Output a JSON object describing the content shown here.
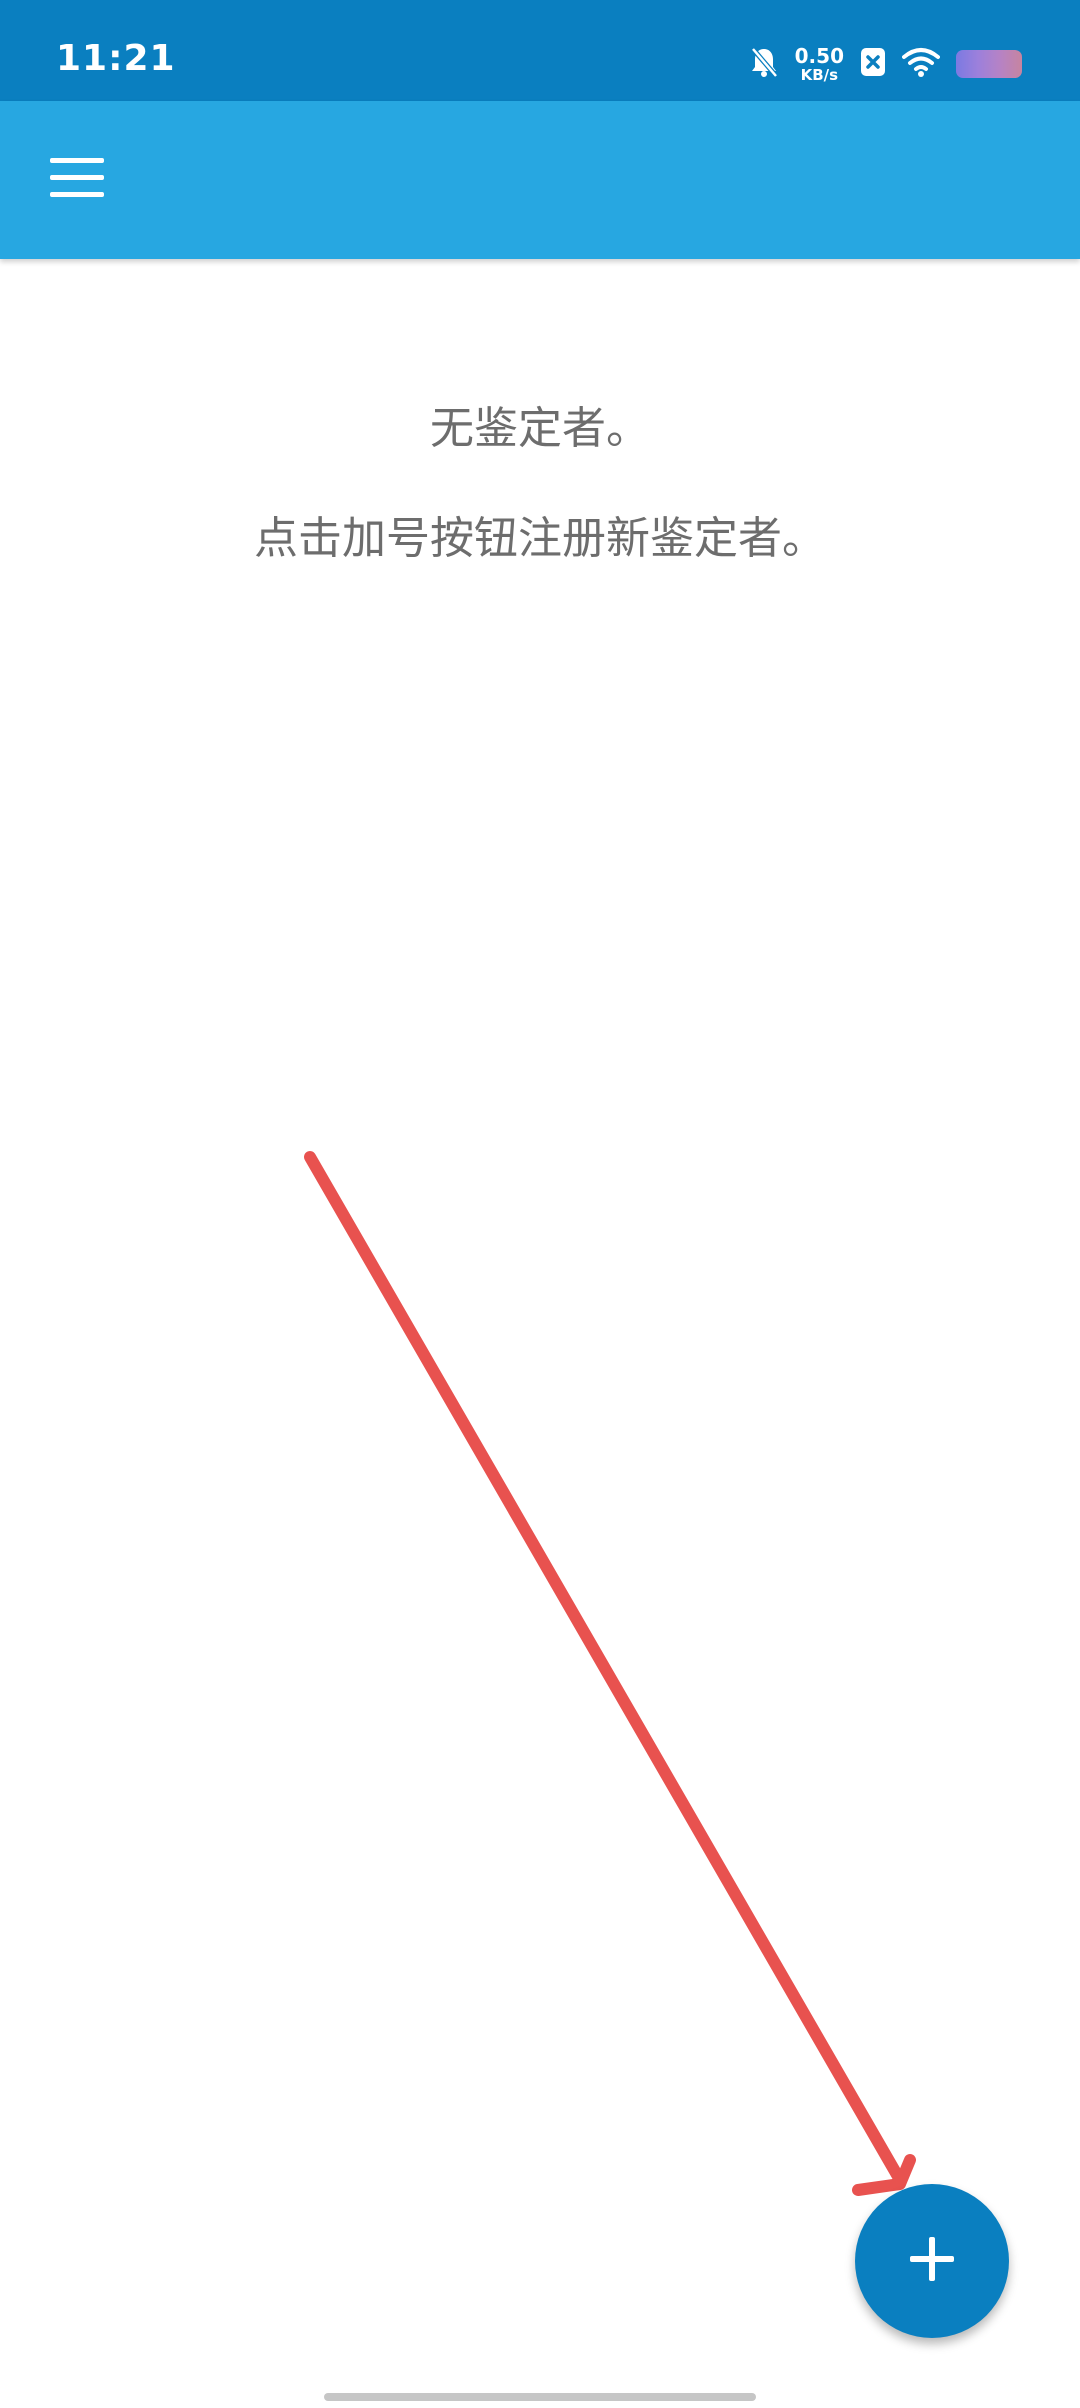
{
  "status_bar": {
    "time": "11:21",
    "net_speed_value": "0.50",
    "net_speed_unit": "KB/s",
    "icons": [
      "bell-muted-icon",
      "close-box-icon",
      "wifi-icon",
      "battery-icon"
    ]
  },
  "app_bar": {
    "menu_icon": "hamburger-menu-icon"
  },
  "empty_state": {
    "title": "无鉴定者。",
    "hint": "点击加号按钮注册新鉴定者。"
  },
  "fab": {
    "icon": "plus-icon"
  },
  "colors": {
    "status_bar": "#0a7fc0",
    "app_bar": "#27a7e1",
    "fab": "#0a7fc0",
    "annotation_arrow": "#e8524f",
    "empty_text": "#6d6d6d"
  }
}
